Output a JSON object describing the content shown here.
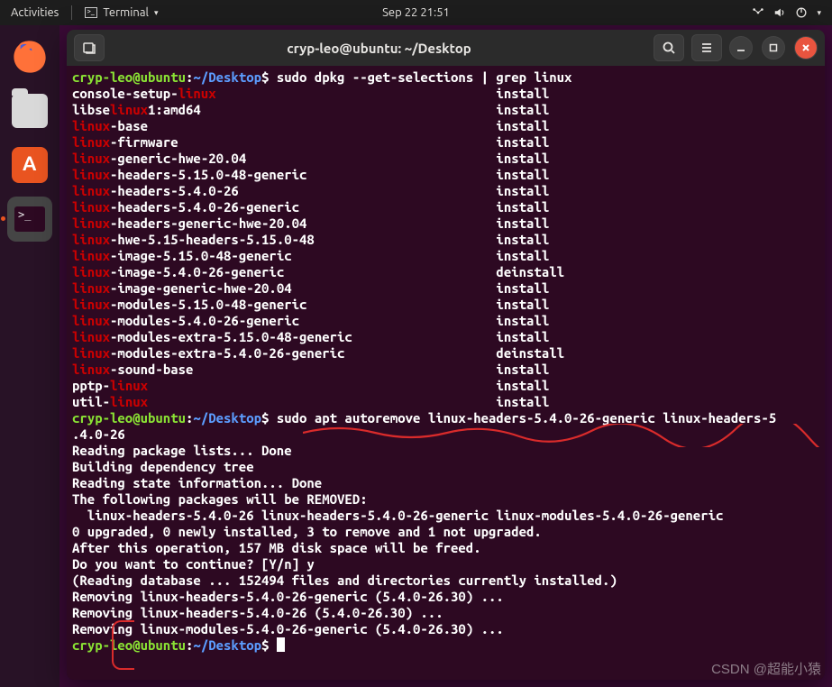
{
  "topbar": {
    "activities": "Activities",
    "terminal_label": "Terminal",
    "datetime": "Sep 22  21:51"
  },
  "window": {
    "title": "cryp-leo@ubuntu: ~/Desktop"
  },
  "prompt": {
    "user_host": "cryp-leo@ubuntu",
    "sep": ":",
    "path": "~/Desktop",
    "dollar": "$"
  },
  "commands": {
    "cmd1": " sudo dpkg --get-selections | grep linux",
    "cmd2": " sudo apt autoremove linux-headers-5.4.0-26-generic linux-headers-5",
    "cmd2_cont": ".4.0-26"
  },
  "pkg_list": [
    {
      "pre": "console-setup-",
      "hl": "linux",
      "post": "",
      "status": "install"
    },
    {
      "pre": "libse",
      "hl": "linux",
      "post": "1:amd64",
      "status": "install"
    },
    {
      "pre": "",
      "hl": "linux",
      "post": "-base",
      "status": "install"
    },
    {
      "pre": "",
      "hl": "linux",
      "post": "-firmware",
      "status": "install"
    },
    {
      "pre": "",
      "hl": "linux",
      "post": "-generic-hwe-20.04",
      "status": "install"
    },
    {
      "pre": "",
      "hl": "linux",
      "post": "-headers-5.15.0-48-generic",
      "status": "install"
    },
    {
      "pre": "",
      "hl": "linux",
      "post": "-headers-5.4.0-26",
      "status": "install"
    },
    {
      "pre": "",
      "hl": "linux",
      "post": "-headers-5.4.0-26-generic",
      "status": "install"
    },
    {
      "pre": "",
      "hl": "linux",
      "post": "-headers-generic-hwe-20.04",
      "status": "install"
    },
    {
      "pre": "",
      "hl": "linux",
      "post": "-hwe-5.15-headers-5.15.0-48",
      "status": "install"
    },
    {
      "pre": "",
      "hl": "linux",
      "post": "-image-5.15.0-48-generic",
      "status": "install"
    },
    {
      "pre": "",
      "hl": "linux",
      "post": "-image-5.4.0-26-generic",
      "status": "deinstall"
    },
    {
      "pre": "",
      "hl": "linux",
      "post": "-image-generic-hwe-20.04",
      "status": "install"
    },
    {
      "pre": "",
      "hl": "linux",
      "post": "-modules-5.15.0-48-generic",
      "status": "install"
    },
    {
      "pre": "",
      "hl": "linux",
      "post": "-modules-5.4.0-26-generic",
      "status": "install"
    },
    {
      "pre": "",
      "hl": "linux",
      "post": "-modules-extra-5.15.0-48-generic",
      "status": "install"
    },
    {
      "pre": "",
      "hl": "linux",
      "post": "-modules-extra-5.4.0-26-generic",
      "status": "deinstall"
    },
    {
      "pre": "",
      "hl": "linux",
      "post": "-sound-base",
      "status": "install"
    },
    {
      "pre": "pptp-",
      "hl": "linux",
      "post": "",
      "status": "install"
    },
    {
      "pre": "util-",
      "hl": "linux",
      "post": "",
      "status": "install"
    }
  ],
  "apt_output": [
    "Reading package lists... Done",
    "Building dependency tree",
    "Reading state information... Done",
    "The following packages will be REMOVED:",
    "  linux-headers-5.4.0-26 linux-headers-5.4.0-26-generic linux-modules-5.4.0-26-generic",
    "0 upgraded, 0 newly installed, 3 to remove and 1 not upgraded.",
    "After this operation, 157 MB disk space will be freed.",
    "Do you want to continue? [Y/n] y",
    "(Reading database ... 152494 files and directories currently installed.)",
    "Removing linux-headers-5.4.0-26-generic (5.4.0-26.30) ...",
    "Removing linux-headers-5.4.0-26 (5.4.0-26.30) ...",
    "Removing linux-modules-5.4.0-26-generic (5.4.0-26.30) ..."
  ],
  "watermark": "CSDN @超能小猿",
  "colors": {
    "prompt_green": "#8ae234",
    "prompt_blue": "#5c9dff",
    "highlight_red": "#cc0000",
    "terminal_bg": "#2d0922",
    "close_btn": "#e9543f"
  }
}
